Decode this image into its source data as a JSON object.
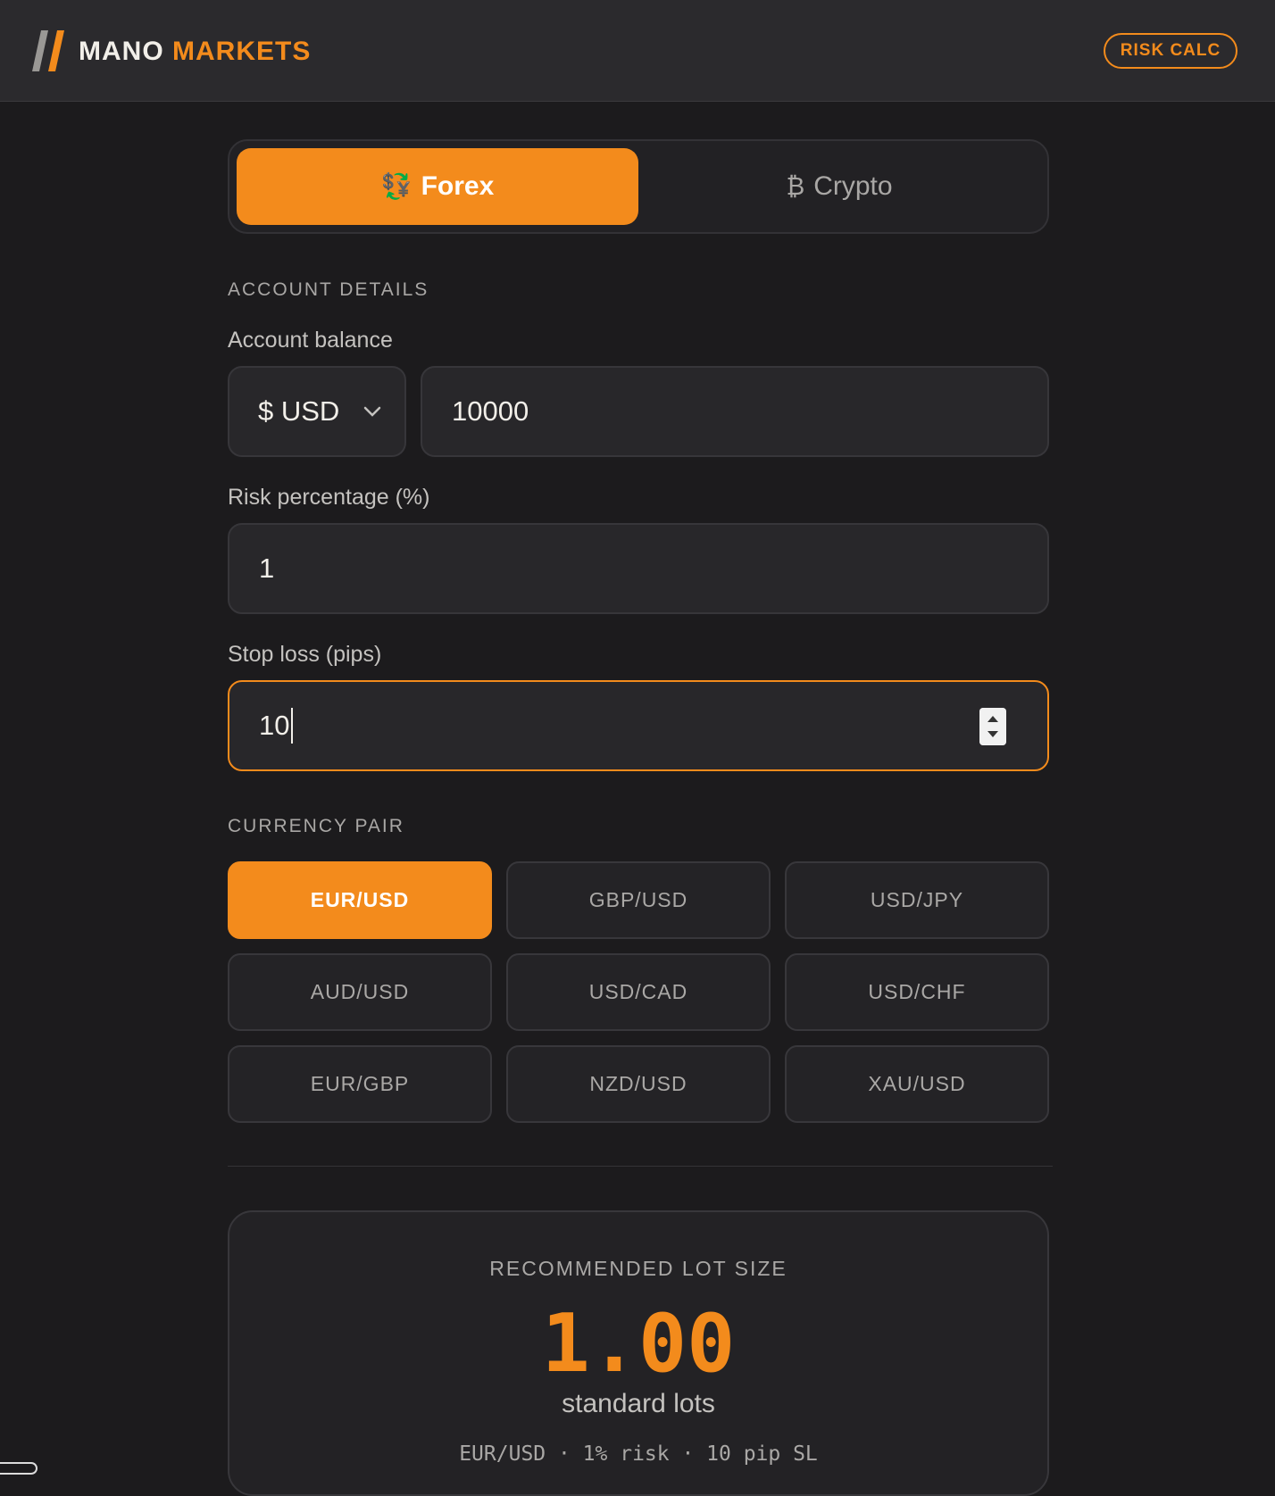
{
  "header": {
    "brand_word1": "MANO",
    "brand_word2": "MARKETS",
    "risk_calc_label": "RISK CALC"
  },
  "tabs": [
    {
      "label": "Forex",
      "icon": "currency-exchange-icon",
      "active": true
    },
    {
      "label": "Crypto",
      "icon": "bitcoin-icon",
      "active": false
    }
  ],
  "account": {
    "section_label": "ACCOUNT DETAILS",
    "balance_label": "Account balance",
    "currency_value": "$ USD",
    "balance_value": "10000",
    "risk_label": "Risk percentage (%)",
    "risk_value": "1",
    "stop_loss_label": "Stop loss (pips)",
    "stop_loss_value": "10"
  },
  "pairs": {
    "section_label": "CURRENCY PAIR",
    "items": [
      "EUR/USD",
      "GBP/USD",
      "USD/JPY",
      "AUD/USD",
      "USD/CAD",
      "USD/CHF",
      "EUR/GBP",
      "NZD/USD",
      "XAU/USD"
    ],
    "selected": "EUR/USD"
  },
  "result": {
    "label": "RECOMMENDED LOT SIZE",
    "value": "1.00",
    "unit": "standard lots",
    "summary": "EUR/USD · 1% risk · 10 pip SL"
  },
  "colors": {
    "accent": "#f38b1c",
    "background": "#1c1b1d",
    "topbar": "#2b2a2d"
  }
}
